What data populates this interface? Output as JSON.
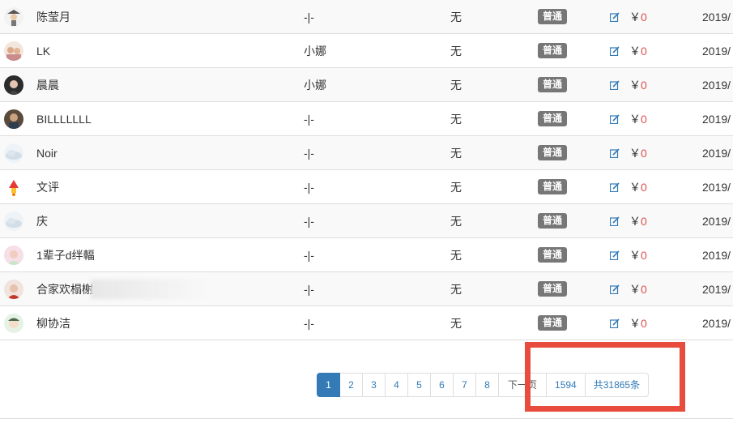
{
  "rows": [
    {
      "name": "陈莹月",
      "inviter": "-|-",
      "level": "无",
      "badge": "普通",
      "currency": "￥",
      "amount": "0",
      "date": "2019/",
      "avatar": "avatar-hat"
    },
    {
      "name": "LK",
      "inviter": "小娜",
      "level": "无",
      "badge": "普通",
      "currency": "￥",
      "amount": "0",
      "date": "2019/",
      "avatar": "avatar-couple"
    },
    {
      "name": "晨晨",
      "inviter": "小娜",
      "level": "无",
      "badge": "普通",
      "currency": "￥",
      "amount": "0",
      "date": "2019/",
      "avatar": "avatar-girl-dark"
    },
    {
      "name": "BILLLLLLL",
      "inviter": "-|-",
      "level": "无",
      "badge": "普通",
      "currency": "￥",
      "amount": "0",
      "date": "2019/",
      "avatar": "avatar-man"
    },
    {
      "name": "Noir",
      "inviter": "-|-",
      "level": "无",
      "badge": "普通",
      "currency": "￥",
      "amount": "0",
      "date": "2019/",
      "avatar": "avatar-default"
    },
    {
      "name": "文评",
      "inviter": "-|-",
      "level": "无",
      "badge": "普通",
      "currency": "￥",
      "amount": "0",
      "date": "2019/",
      "avatar": "avatar-flame"
    },
    {
      "name": "庆",
      "inviter": "-|-",
      "level": "无",
      "badge": "普通",
      "currency": "￥",
      "amount": "0",
      "date": "2019/",
      "avatar": "avatar-default"
    },
    {
      "name": "1辈子d绊輻",
      "inviter": "-|-",
      "level": "无",
      "badge": "普通",
      "currency": "￥",
      "amount": "0",
      "date": "2019/",
      "avatar": "avatar-girl-pink"
    },
    {
      "name": "合家欢榻榭",
      "inviter": "-|-",
      "level": "无",
      "badge": "普通",
      "currency": "￥",
      "amount": "0",
      "date": "2019/",
      "avatar": "avatar-girl-red"
    },
    {
      "name": "柳协洁",
      "inviter": "-|-",
      "level": "无",
      "badge": "普通",
      "currency": "￥",
      "amount": "0",
      "date": "2019/",
      "avatar": "avatar-cartoon"
    }
  ],
  "pagination": {
    "pages": [
      "1",
      "2",
      "3",
      "4",
      "5",
      "6",
      "7",
      "8"
    ],
    "active": "1",
    "next": "下一页",
    "last_page": "1594",
    "total": "共31865条"
  },
  "colors": {
    "highlight": "#e74c3c",
    "accent": "#337ab7",
    "amount": "#d9534f",
    "badge": "#777777"
  }
}
